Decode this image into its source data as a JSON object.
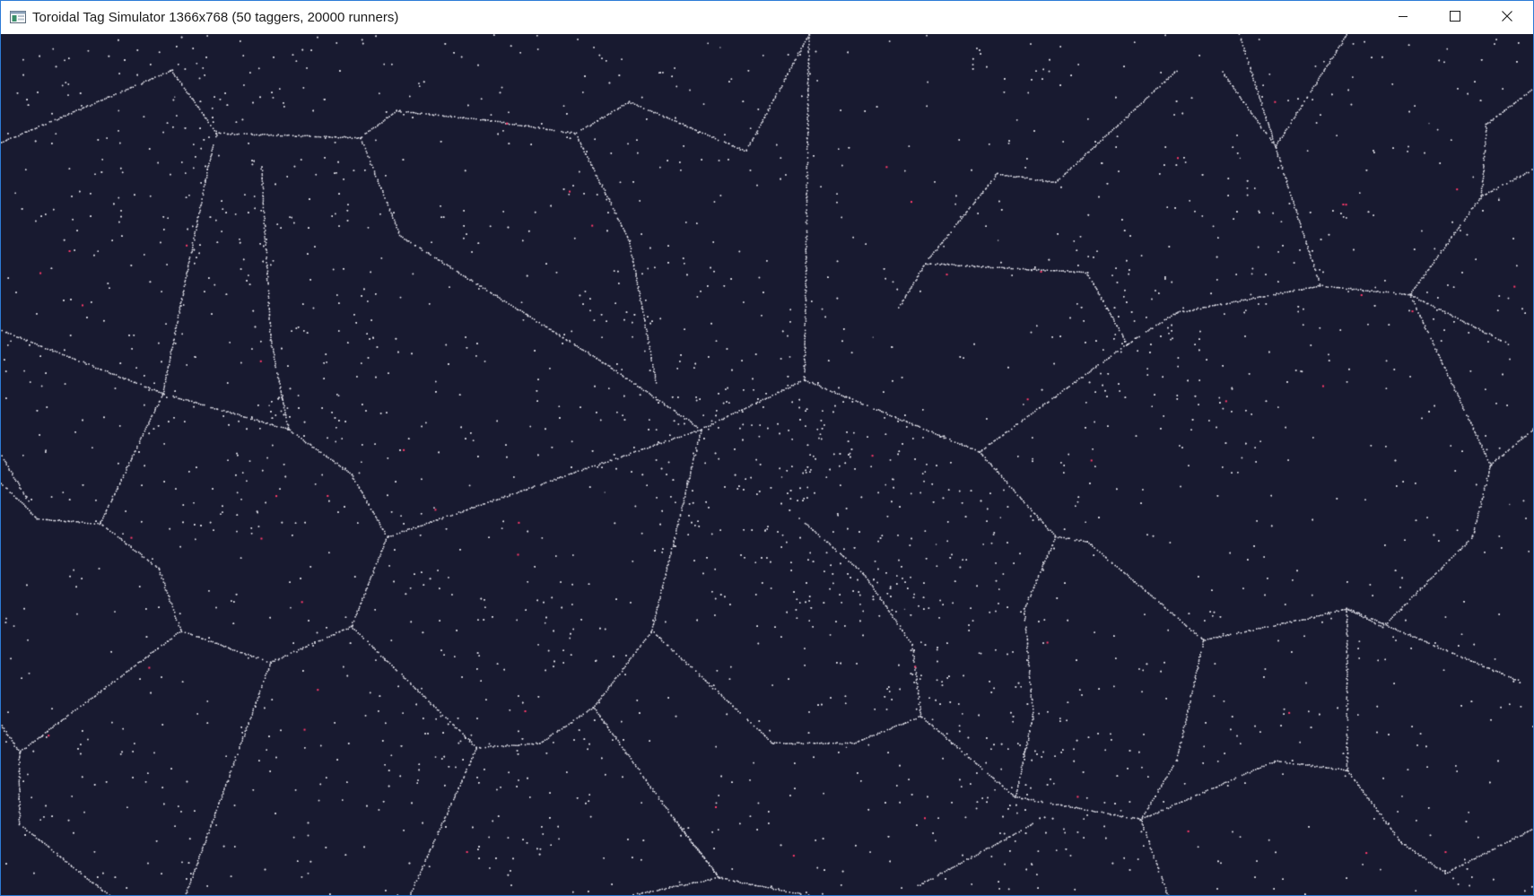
{
  "window": {
    "title": "Toroidal Tag Simulator 1366x768 (50 taggers, 20000 runners)",
    "app_icon": "window-app-icon",
    "controls": {
      "minimize_icon": "minimize-icon",
      "maximize_icon": "maximize-icon",
      "close_icon": "close-icon"
    }
  },
  "simulation": {
    "width": 1366,
    "height": 768,
    "taggers": 50,
    "runners": 20000,
    "colors": {
      "background": "#181a30",
      "runner": "#d8d8e2",
      "tagger": "#ff3b6b",
      "window_border": "#2d7bd6"
    }
  }
}
